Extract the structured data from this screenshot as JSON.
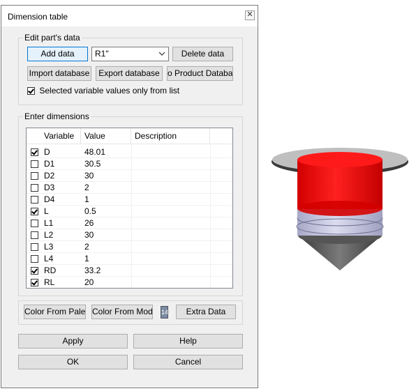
{
  "window": {
    "title": "Dimension table"
  },
  "part_group": {
    "label": "Edit part's data",
    "add_data": "Add data",
    "dropdown_value": "R1\"",
    "delete_data": "Delete data",
    "import_database": "Import database",
    "export_database": "Export database",
    "to_product_database": "o Product Databas",
    "selected_only_label": "Selected variable values only from list",
    "selected_only_checked": true
  },
  "dims_group": {
    "label": "Enter dimensions",
    "columns": [
      "Variable",
      "Value",
      "Description"
    ],
    "rows": [
      {
        "checked": true,
        "variable": "D",
        "value": "48.01",
        "description": ""
      },
      {
        "checked": false,
        "variable": "D1",
        "value": "30.5",
        "description": ""
      },
      {
        "checked": false,
        "variable": "D2",
        "value": "30",
        "description": ""
      },
      {
        "checked": false,
        "variable": "D3",
        "value": "2",
        "description": ""
      },
      {
        "checked": false,
        "variable": "D4",
        "value": "1",
        "description": ""
      },
      {
        "checked": true,
        "variable": "L",
        "value": "0.5",
        "description": ""
      },
      {
        "checked": false,
        "variable": "L1",
        "value": "26",
        "description": ""
      },
      {
        "checked": false,
        "variable": "L2",
        "value": "30",
        "description": ""
      },
      {
        "checked": false,
        "variable": "L3",
        "value": "2",
        "description": ""
      },
      {
        "checked": false,
        "variable": "L4",
        "value": "1",
        "description": ""
      },
      {
        "checked": true,
        "variable": "RD",
        "value": "33.2",
        "description": ""
      },
      {
        "checked": true,
        "variable": "RL",
        "value": "20",
        "description": ""
      }
    ]
  },
  "color_bar": {
    "color_from_palette": "Color From Palette",
    "color_from_model": "Color From Model",
    "swatch_text": "14",
    "extra_data": "Extra Data"
  },
  "footer": {
    "apply": "Apply",
    "help": "Help",
    "ok": "OK",
    "cancel": "Cancel"
  },
  "preview": {
    "colors": {
      "body": "#ff1a1a",
      "rings": "#c8c8e6",
      "flange": "#4a4a4a"
    }
  }
}
